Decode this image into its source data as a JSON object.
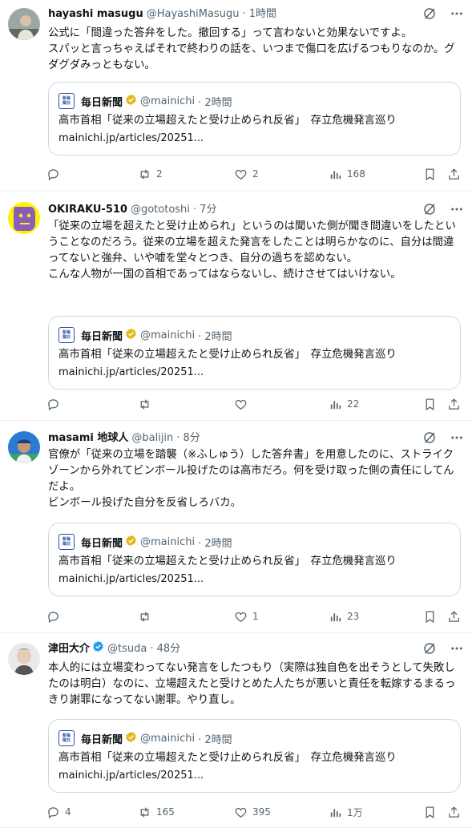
{
  "tweets": [
    {
      "display_name": "hayashi masugu",
      "handle": "@HayashiMasugu",
      "time": "· 1時間",
      "verified": false,
      "avatar": "person-photo",
      "text": "公式に「間違った答弁をした。撤回する」って言わないと効果ないですよ。\nスパッと言っちゃえばそれで終わりの話を、いつまで傷口を広げるつもりなのか。グダグダみっともない。",
      "quote": {
        "name": "毎日新聞",
        "handle": "@mainichi",
        "time": "· 2時間",
        "title": "高市首相「従来の立場超えたと受け止められ反省」　存立危機発言巡り",
        "url": "mainichi.jp/articles/20251..."
      },
      "stats": {
        "replies": "",
        "reposts": "2",
        "likes": "2",
        "views": "168"
      }
    },
    {
      "display_name": "OKIRAKU-510",
      "handle": "@gototoshi",
      "time": "· 7分",
      "verified": false,
      "avatar": "purple-face",
      "text": "「従来の立場を超えたと受け止められ」というのは聞いた側が聞き間違いをしたということなのだろう。従来の立場を超えた発言をしたことは明らかなのに、自分は間違ってないと強弁、いや嘘を堂々とつき、自分の過ちを認めない。\nこんな人物が一国の首相であってはならないし、続けさせてはいけない。",
      "quote": {
        "name": "毎日新聞",
        "handle": "@mainichi",
        "time": "· 2時間",
        "title": "高市首相「従来の立場超えたと受け止められ反省」　存立危機発言巡り",
        "url": "mainichi.jp/articles/20251..."
      },
      "stats": {
        "replies": "",
        "reposts": "",
        "likes": "",
        "views": "22"
      }
    },
    {
      "display_name": "masami 地球人",
      "handle": "@balijin",
      "time": "· 8分",
      "verified": false,
      "avatar": "person-cap",
      "text": "官僚が「従来の立場を踏襲（※ふしゅう）した答弁書」を用意したのに、ストライクゾーンから外れてビンボール投げたのは高市だろ。何を受け取った側の責任にしてんだよ。\nビンボール投げた自分を反省しろバカ。",
      "quote": {
        "name": "毎日新聞",
        "handle": "@mainichi",
        "time": "· 2時間",
        "title": "高市首相「従来の立場超えたと受け止められ反省」　存立危機発言巡り",
        "url": "mainichi.jp/articles/20251..."
      },
      "stats": {
        "replies": "",
        "reposts": "",
        "likes": "1",
        "views": "23"
      }
    },
    {
      "display_name": "津田大介",
      "handle": "@tsuda",
      "time": "· 48分",
      "verified": true,
      "avatar": "person-gray",
      "text": "本人的には立場変わってない発言をしたつもり（実際は独自色を出そうとして失敗したのは明白）なのに、立場超えたと受けとめた人たちが悪いと責任を転嫁するまるっきり謝罪になってない謝罪。やり直し。",
      "quote": {
        "name": "毎日新聞",
        "handle": "@mainichi",
        "time": "· 2時間",
        "title": "高市首相「従来の立場超えたと受け止められ反省」　存立危機発言巡り",
        "url": "mainichi.jp/articles/20251..."
      },
      "stats": {
        "replies": "4",
        "reposts": "165",
        "likes": "395",
        "views": "1万"
      }
    }
  ],
  "quote_logo_text": [
    "新毎",
    "聞日"
  ],
  "colors": {
    "text": "#0f1419",
    "muted": "#536471",
    "border": "#cfd9de",
    "divider": "#eff3f4",
    "verified_gold": "#e2b719",
    "verified_blue": "#1d9bf0"
  },
  "icons": [
    "grok-icon",
    "more-icon",
    "reply-icon",
    "repost-icon",
    "like-icon",
    "views-icon",
    "bookmark-icon",
    "share-icon",
    "verified-badge-icon"
  ]
}
